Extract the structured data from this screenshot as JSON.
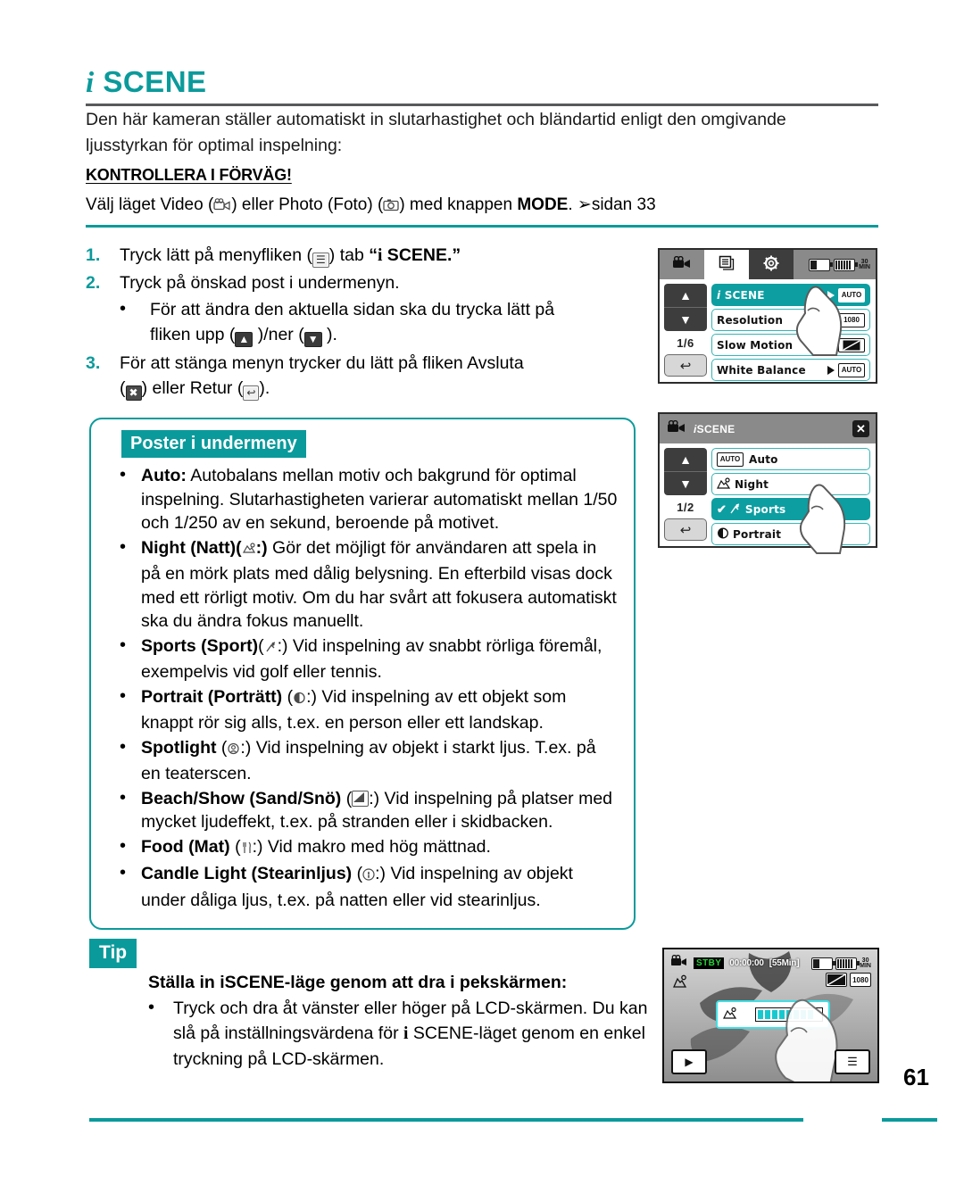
{
  "page": {
    "number": "61",
    "title_prefix": "i",
    "title": "SCENE"
  },
  "intro": {
    "paragraph": "Den här kameran ställer automatiskt in slutarhastighet och bländartid enligt den omgivande ljusstyrkan för optimal inspelning:",
    "check_heading": "KONTROLLERA I FÖRVÄG!",
    "mode_line_a": "Välj läget Video (",
    "mode_line_b": ") eller Photo (Foto) (",
    "mode_line_c": ") med knappen ",
    "mode_bold": "MODE",
    "mode_line_d": ". ",
    "mode_ref": "sidan 33"
  },
  "steps": [
    {
      "num": "1.",
      "text_a": "Tryck lätt på menyfliken (",
      "icon": "menu-tab-icon",
      "text_b": ") tab ",
      "arrow": "→",
      "quote": "“",
      "scene_i": "i",
      "scene": " SCENE.”"
    },
    {
      "num": "2.",
      "text_a": "Tryck på önskad post i undermenyn."
    },
    {
      "num": "3.",
      "text_a": "För att stänga menyn trycker du lätt på fliken Avsluta",
      "text_b": "(",
      "text_c": ") eller Retur (",
      "text_d": ")."
    }
  ],
  "substep": {
    "bullet": "•",
    "text_a": "För att ändra den aktuella sidan ska du trycka lätt på",
    "text_b": "fliken upp (",
    "text_c": " )/ner (",
    "text_d": " )."
  },
  "submenu_box": {
    "label": "Poster i undermeny",
    "bullet": "•",
    "items": [
      {
        "term": "Auto:",
        "icon": "",
        "desc": " Autobalans mellan motiv och bakgrund för optimal inspelning. Slutarhastigheten varierar automatiskt mellan 1/50 och 1/250 av en sekund, beroende på motivet."
      },
      {
        "term": "Night (Natt)",
        "icon": "night-icon",
        "after_icon": ":",
        "desc": " Gör det möjligt för användaren att spela in på en mörk plats med dålig belysning. En efterbild visas dock med ett rörligt motiv. Om du har svårt att fokusera automatiskt ska du ändra fokus manuellt."
      },
      {
        "term": "Sports (Sport)",
        "icon": "sports-icon",
        "after_icon": ":",
        "desc": " Vid inspelning av snabbt rörliga föremål, exempelvis vid golf eller tennis."
      },
      {
        "term": "Portrait (Porträtt)",
        "icon": "portrait-icon",
        "after_icon": ":",
        "desc": " Vid inspelning av ett objekt som knappt rör sig alls, t.ex. en person eller ett landskap."
      },
      {
        "term": "Spotlight",
        "icon": "spotlight-icon",
        "after_icon": ":",
        "desc": " Vid inspelning av objekt i starkt ljus. T.ex. på en teaterscen."
      },
      {
        "term": "Beach/Show (Sand/Snö)",
        "icon": "beach-icon",
        "after_icon": ":",
        "desc": " Vid inspelning på platser med mycket ljudeffekt, t.ex. på stranden eller i skidbacken."
      },
      {
        "term": "Food (Mat)",
        "icon": "food-icon",
        "after_icon": ":",
        "desc": " Vid makro med hög mättnad."
      },
      {
        "term": "Candle Light (Stearinljus)",
        "icon": "candle-icon",
        "after_icon": ":",
        "desc": " Vid inspelning av objekt under dåliga ljus, t.ex. på natten eller vid stearinljus."
      }
    ]
  },
  "tip": {
    "label": "Tip",
    "heading": "Ställa in iSCENE-läge genom att dra i pekskärmen:",
    "bullet": "•",
    "body_a": "Tryck och dra åt vänster eller höger på LCD-skärmen. Du kan slå på inställningsvärdena för ",
    "body_i": "i",
    "body_b": " SCENE-läget genom en enkel tryckning på LCD-skärmen."
  },
  "screen_menu": {
    "tabs": [
      {
        "name": "video-tab",
        "icon": "camcorder-icon"
      },
      {
        "name": "menu-tab",
        "icon": "list-icon",
        "active": true
      },
      {
        "name": "settings-tab",
        "icon": "gear-icon"
      }
    ],
    "battery_min": "30",
    "battery_min_unit": "MIN",
    "nav_up": "▲",
    "nav_down": "▼",
    "page_indicator": "1/6",
    "return_icon": "↩",
    "rows": [
      {
        "label_i": "i",
        "label": " SCENE",
        "value": "AUTO",
        "arrow": true,
        "selected": true
      },
      {
        "label": "Resolution",
        "value": "1080",
        "arrow": false,
        "selected": false
      },
      {
        "label": "Slow Motion",
        "value": "",
        "arrow": true,
        "selected": false
      },
      {
        "label": "White Balance",
        "value": "AUTO",
        "arrow": true,
        "selected": false
      }
    ]
  },
  "screen_submenu": {
    "title_i": "i",
    "title": "SCENE",
    "close": "✕",
    "nav_up": "▲",
    "nav_down": "▼",
    "page_indicator": "1/2",
    "return_icon": "↩",
    "rows": [
      {
        "icon_label": "AUTO",
        "label": "Auto",
        "selected": false
      },
      {
        "icon_label": "",
        "label": "Night",
        "selected": false
      },
      {
        "icon_label": "",
        "label": "Sports",
        "selected": true,
        "check": "✔"
      },
      {
        "icon_label": "",
        "label": "Portrait",
        "selected": false
      }
    ]
  },
  "screen_lcd": {
    "stby": "STBY",
    "timecode": "00:00:00",
    "remaining": "[55Min]",
    "battery_min": "30",
    "battery_min_unit": "MIN",
    "quality": "1080",
    "play_icon": "▶",
    "menu_icon": "☰"
  },
  "colors": {
    "teal": "#0b9a9b",
    "screen_teal": "#0d9ea1",
    "rule_gray": "#58595b"
  }
}
